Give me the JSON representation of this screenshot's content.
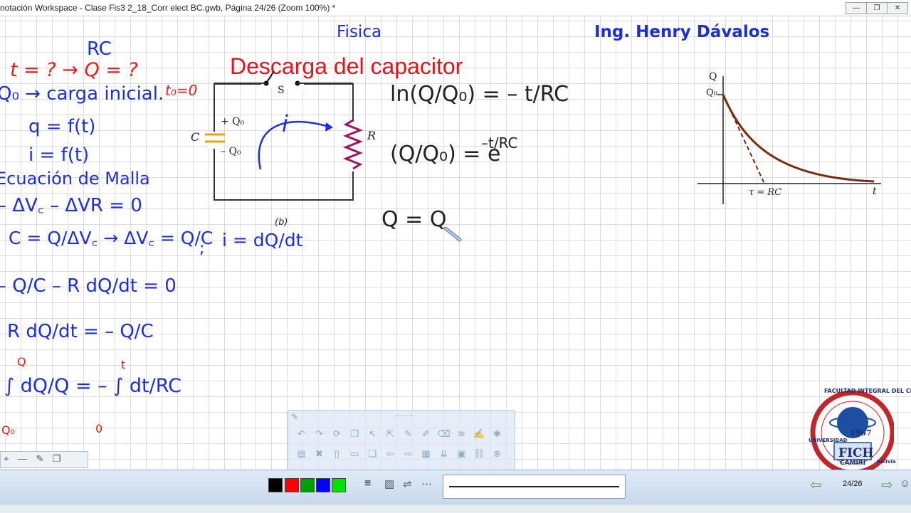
{
  "window": {
    "title": "notación Workspace - Clase Fis3 2_18_Corr elect BC.gwb, Página 24/26  (Zoom 100%) *",
    "controls": [
      "—",
      "❐",
      "✕"
    ]
  },
  "header": {
    "course": "Fisica",
    "author": "Ing.  Henry Dávalos",
    "subtitle": "Descarga del capacitor"
  },
  "left_notes": {
    "rc": "RC",
    "unknowns": "t = ?  → Q = ?",
    "q0": "Q₀ → carga inicial.",
    "t0": "t₀=0",
    "qf": "q = f(t)",
    "if": "i = f(t)",
    "mesh_title": "Ecuación de Malla",
    "mesh_eq": "– ΔV꜀ – ΔVR = 0",
    "cap_eq": "C = Q/ΔV꜀ → ΔV꜀ = Q/C",
    "semicolon": ";",
    "current_eq": "i = dQ/dt",
    "eq1": "– Q/C – R dQ/dt = 0",
    "eq2": "R dQ/dt = – Q/C",
    "integral_eq": "∫ dQ/Q = – ∫ dt/RC",
    "int_upper_q": "Q",
    "int_lower_q": "Q₀",
    "int_upper_t": "t",
    "int_lower_t": "0"
  },
  "circuit": {
    "switch_label": "S",
    "cap_label": "C",
    "plus_q": "+ Q₀",
    "minus_q": "– Q₀",
    "resistor_label": "R",
    "current_label": "i",
    "fig_label": "(b)"
  },
  "right_notes": {
    "ln_eq": "ln(Q/Q₀) = – t/RC",
    "exp_eq": "(Q/Q₀) = e",
    "exp_power": "–t/RC",
    "result": "Q = Q"
  },
  "graph": {
    "y_label": "Q",
    "q0_label": "Q₀",
    "tau_label": "τ = RC",
    "x_label": "t",
    "curve_color": "#7a2a12"
  },
  "logo": {
    "text_top": "FACULTAD INTEGRAL DEL CHACO",
    "year": "1967",
    "acronym": "FICH",
    "city": "CAMIRI",
    "left_arc": "UNIVERSIDAD",
    "right_arc": "Bolivia"
  },
  "palette": {
    "colors": [
      "#000000",
      "#ff0000",
      "#00a000",
      "#0000ff",
      "#00e000"
    ],
    "pager": "24/26"
  }
}
